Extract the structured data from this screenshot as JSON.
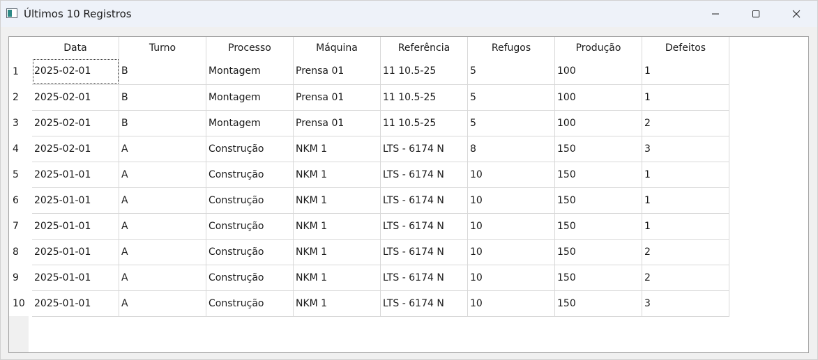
{
  "window": {
    "title": "Últimos 10 Registros"
  },
  "icons": {
    "app": "app-window-icon",
    "minimize": "minimize-icon",
    "maximize": "maximize-icon",
    "close": "close-icon"
  },
  "table": {
    "columns": [
      "Data",
      "Turno",
      "Processo",
      "Máquina",
      "Referência",
      "Refugos",
      "Produção",
      "Defeitos"
    ],
    "row_labels": [
      "1",
      "2",
      "3",
      "4",
      "5",
      "6",
      "7",
      "8",
      "9",
      "10"
    ],
    "rows": [
      [
        "2025-02-01",
        "B",
        "Montagem",
        "Prensa 01",
        "11 10.5-25",
        "5",
        "100",
        "1"
      ],
      [
        "2025-02-01",
        "B",
        "Montagem",
        "Prensa 01",
        "11 10.5-25",
        "5",
        "100",
        "1"
      ],
      [
        "2025-02-01",
        "B",
        "Montagem",
        "Prensa 01",
        "11 10.5-25",
        "5",
        "100",
        "2"
      ],
      [
        "2025-02-01",
        "A",
        "Construção",
        "NKM 1",
        "LTS - 6174 N",
        "8",
        "150",
        "3"
      ],
      [
        "2025-01-01",
        "A",
        "Construção",
        "NKM 1",
        "LTS - 6174 N",
        "10",
        "150",
        "1"
      ],
      [
        "2025-01-01",
        "A",
        "Construção",
        "NKM 1",
        "LTS - 6174 N",
        "10",
        "150",
        "1"
      ],
      [
        "2025-01-01",
        "A",
        "Construção",
        "NKM 1",
        "LTS - 6174 N",
        "10",
        "150",
        "1"
      ],
      [
        "2025-01-01",
        "A",
        "Construção",
        "NKM 1",
        "LTS - 6174 N",
        "10",
        "150",
        "2"
      ],
      [
        "2025-01-01",
        "A",
        "Construção",
        "NKM 1",
        "LTS - 6174 N",
        "10",
        "150",
        "2"
      ],
      [
        "2025-01-01",
        "A",
        "Construção",
        "NKM 1",
        "LTS - 6174 N",
        "10",
        "150",
        "3"
      ]
    ]
  }
}
